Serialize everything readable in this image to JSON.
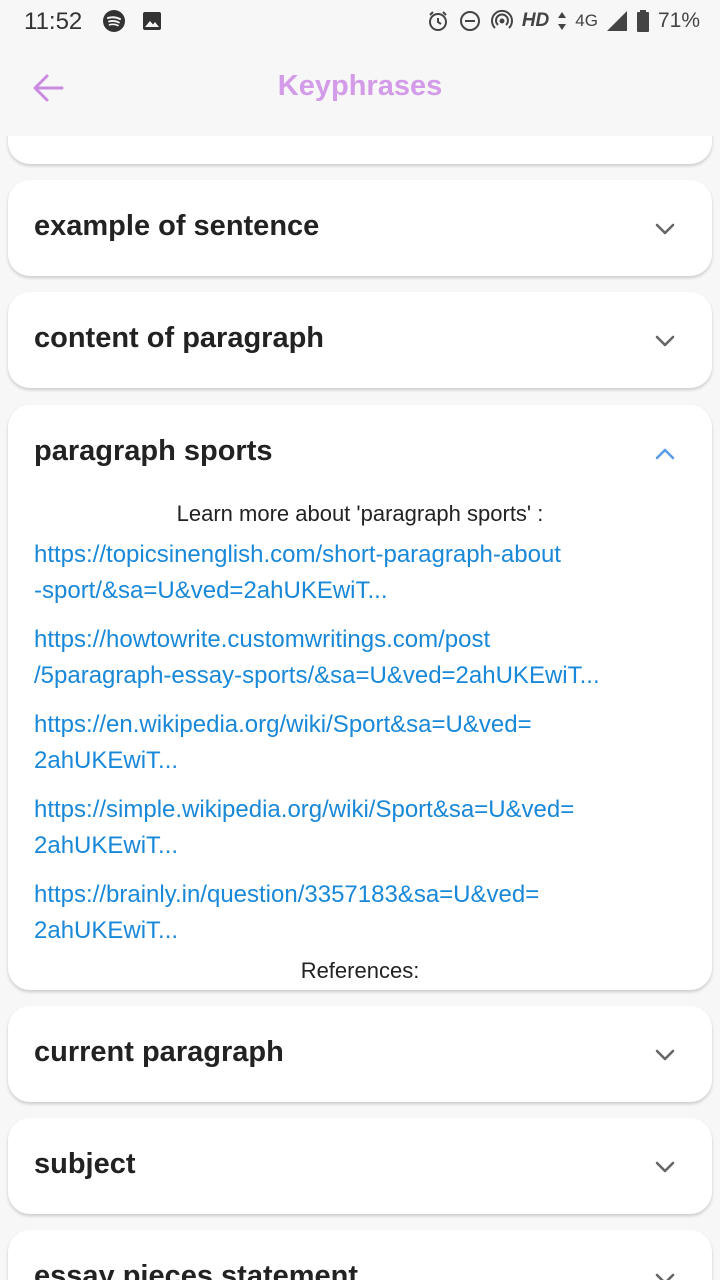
{
  "status_bar": {
    "time": "11:52",
    "network_hd": "HD",
    "network_type": "4G",
    "battery": "71%"
  },
  "app_bar": {
    "title": "Keyphrases",
    "back_icon": "arrow-left-icon"
  },
  "colors": {
    "title": "#d39be8",
    "link": "#1a88d8",
    "chevron_expanded": "#5b9be8"
  },
  "cards": [
    {
      "title": "example of sentence",
      "expanded": false
    },
    {
      "title": "content of paragraph",
      "expanded": false
    },
    {
      "title": "paragraph sports",
      "expanded": true,
      "learn_more": "Learn more about 'paragraph sports' :",
      "links": [
        {
          "line1": "https://topicsinenglish.com/short-paragraph-about",
          "line2": "-sport/&sa=U&ved=2ahUKEwiT..."
        },
        {
          "line1": "https://howtowrite.customwritings.com/post",
          "line2": "/5paragraph-essay-sports/&sa=U&ved=2ahUKEwiT..."
        },
        {
          "line1": "https://en.wikipedia.org/wiki/Sport&sa=U&ved=",
          "line2": "2ahUKEwiT..."
        },
        {
          "line1": "https://simple.wikipedia.org/wiki/Sport&sa=U&ved=",
          "line2": "2ahUKEwiT..."
        },
        {
          "line1": "https://brainly.in/question/3357183&sa=U&ved=",
          "line2": "2ahUKEwiT..."
        }
      ],
      "references_label": "References:"
    },
    {
      "title": "current paragraph",
      "expanded": false
    },
    {
      "title": "subject",
      "expanded": false
    },
    {
      "title": "essay pieces statement",
      "expanded": false
    }
  ]
}
